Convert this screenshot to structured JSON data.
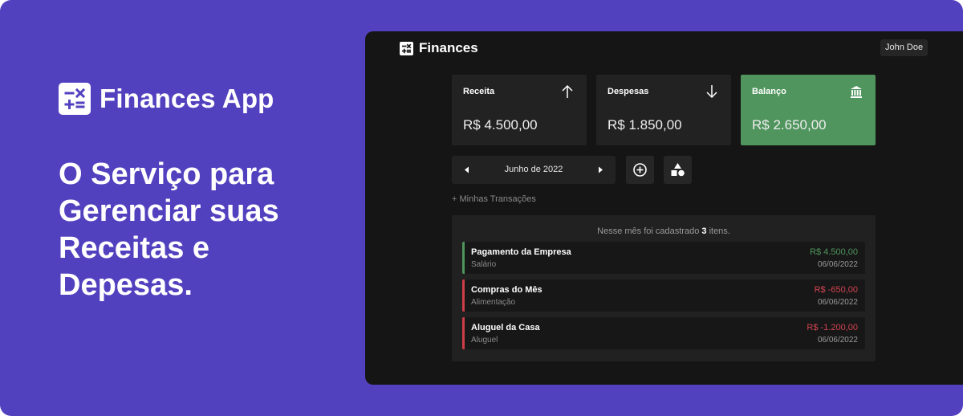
{
  "promo": {
    "brand_name": "Finances App",
    "headline": "O Serviço para Gerenciar suas Receitas e Depesas."
  },
  "app": {
    "title": "Finances",
    "user_name": "John Doe",
    "cards": {
      "income": {
        "label": "Receita",
        "value": "R$ 4.500,00",
        "icon": "arrow-up-icon"
      },
      "expenses": {
        "label": "Despesas",
        "value": "R$ 1.850,00",
        "icon": "arrow-down-icon"
      },
      "balance": {
        "label": "Balanço",
        "value": "R$ 2.650,00",
        "icon": "bank-icon"
      }
    },
    "month_nav": {
      "label": "Junho de 2022"
    },
    "my_transactions_link": "+ Minhas Transações",
    "summary": {
      "prefix": "Nesse mês foi cadastrado",
      "count": "3",
      "suffix": "itens."
    },
    "transactions": [
      {
        "title": "Pagamento da Empresa",
        "category": "Salário",
        "amount": "R$ 4.500,00",
        "date": "06/06/2022",
        "type": "income"
      },
      {
        "title": "Compras do Mês",
        "category": "Alimentação",
        "amount": "R$ -650,00",
        "date": "06/06/2022",
        "type": "expense"
      },
      {
        "title": "Aluguel da Casa",
        "category": "Aluguel",
        "amount": "R$ -1.200,00",
        "date": "06/06/2022",
        "type": "expense"
      }
    ]
  },
  "colors": {
    "background": "#5241bf",
    "income": "#4f955d",
    "expense": "#d24451",
    "app_bg": "#151515"
  }
}
